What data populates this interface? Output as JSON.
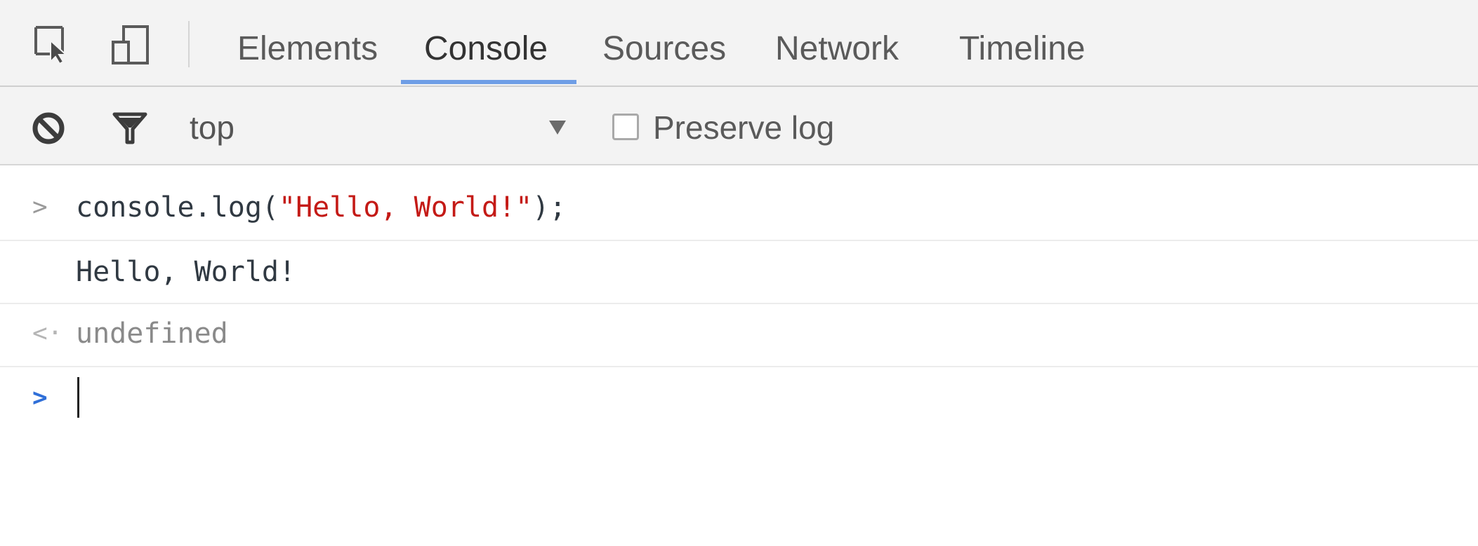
{
  "tabs": {
    "items": [
      {
        "label": "Elements",
        "active": false
      },
      {
        "label": "Console",
        "active": true
      },
      {
        "label": "Sources",
        "active": false
      },
      {
        "label": "Network",
        "active": false
      },
      {
        "label": "Timeline",
        "active": false
      }
    ],
    "active_color": "#6f9ee6",
    "icons": [
      "inspect-element-icon",
      "device-mode-icon"
    ]
  },
  "toolbar": {
    "icons": [
      "clear-console-icon",
      "filter-icon"
    ],
    "context": "top",
    "preserve_log_label": "Preserve log",
    "preserve_log_checked": false
  },
  "console": {
    "input_code_prefix": "console.log(",
    "input_code_string": "\"Hello, World!\"",
    "input_code_suffix": ");",
    "output": "Hello, World!",
    "return_value": "undefined",
    "input_prompt_glyph": ">",
    "log_prompt_glyph": ">",
    "return_glyph": "<·",
    "string_color": "#c41a16",
    "prompt_color": "#2f6fd8"
  }
}
